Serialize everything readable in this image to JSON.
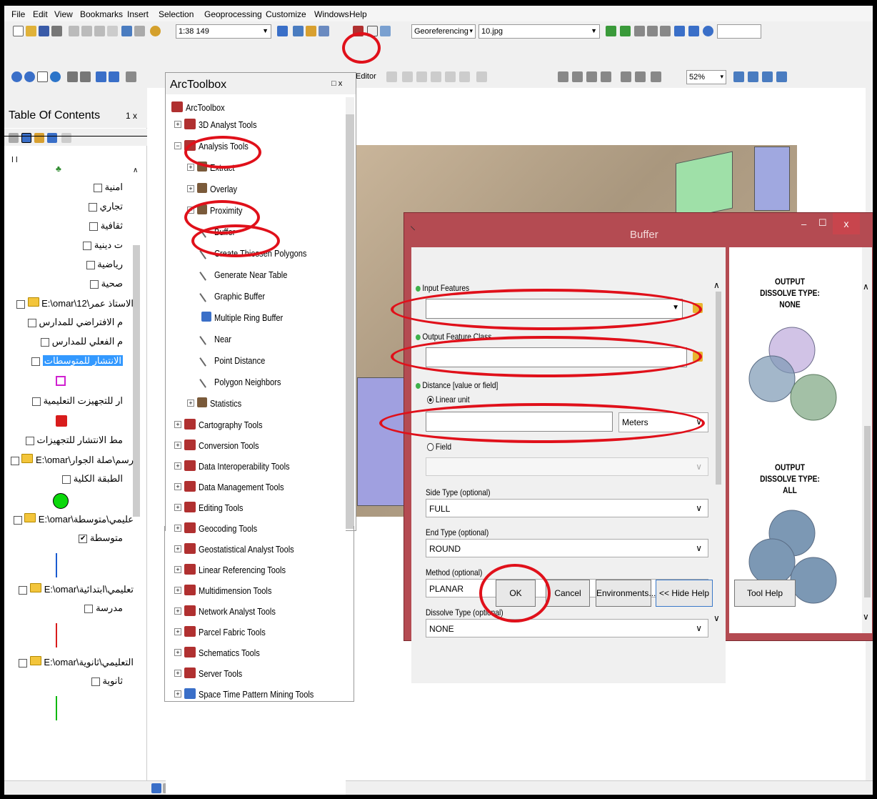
{
  "menu": [
    "File",
    "Edit",
    "View",
    "Bookmarks",
    "Insert",
    "Selection",
    "Geoprocessing",
    "Customize",
    "Windows",
    "Help"
  ],
  "standard_toolbar": {
    "scale": "1:38 149"
  },
  "georef_toolbar": {
    "label": "Georeferencing",
    "layer": "10.jpg"
  },
  "editor_toolbar": {
    "label": "Editor",
    "zoom": "52%"
  },
  "toc": {
    "title": "Table Of Contents",
    "pin": "1 x",
    "rows": [
      "امنية",
      "تجاري",
      "ثقافية",
      "ت دينية",
      "رياضية",
      "صحية",
      "الاستاذ عمر\\12\\E:\\omar",
      "م الافتراضي للمدارس",
      "م الفعلي للمدارس",
      "الانتشار للمتوسطات",
      "ار للتجهيزت التعليمية",
      "مط الانتشار للتجهيزات",
      "رسم\\صلة الجوار\\E:\\omar",
      "الطبقة الكلية",
      "عليمي\\متوسطة\\E:\\omar",
      "متوسطة",
      "تعليمي\\ابتدائية\\E:\\omar",
      "مدرسة",
      "التعليمي\\ثانوية\\E:\\omar",
      "ثانوية"
    ]
  },
  "arctoolbox": {
    "title": "ArcToolbox",
    "root": "ArcToolbox",
    "items": [
      "3D Analyst Tools",
      "Analysis Tools",
      "Extract",
      "Overlay",
      "Proximity",
      "Buffer",
      "Create Thiessen Polygons",
      "Generate Near Table",
      "Graphic Buffer",
      "Multiple Ring Buffer",
      "Near",
      "Point Distance",
      "Polygon Neighbors",
      "Statistics",
      "Cartography Tools",
      "Conversion Tools",
      "Data Interoperability Tools",
      "Data Management Tools",
      "Editing Tools",
      "Geocoding Tools",
      "Geostatistical Analyst Tools",
      "Linear Referencing Tools",
      "Multidimension Tools",
      "Network Analyst Tools",
      "Parcel Fabric Tools",
      "Schematics Tools",
      "Server Tools",
      "Space Time Pattern Mining Tools"
    ]
  },
  "buffer_dialog": {
    "title": "Buffer",
    "input_features_label": "Input Features",
    "input_features_value": "",
    "output_class_label": "Output Feature Class",
    "output_class_value": "",
    "distance_label": "Distance [value or field]",
    "linear_unit_label": "Linear unit",
    "linear_unit_value": "",
    "unit": "Meters",
    "field_label": "Field",
    "side_type_label": "Side Type (optional)",
    "side_type_value": "FULL",
    "end_type_label": "End Type (optional)",
    "end_type_value": "ROUND",
    "method_label": "Method (optional)",
    "method_value": "PLANAR",
    "dissolve_label": "Dissolve Type (optional)",
    "dissolve_value": "NONE",
    "help_none": "OUTPUT\nDISSOLVE TYPE:\nNONE",
    "help_all": "OUTPUT\nDISSOLVE TYPE:\nALL",
    "ok": "OK",
    "cancel": "Cancel",
    "environments": "Environments...",
    "hide_help": "<< Hide Help",
    "tool_help": "Tool Help"
  },
  "colors": {
    "dialog_frame": "#b44b52",
    "highlight": "#e0101a",
    "selection": "#3399ff"
  }
}
